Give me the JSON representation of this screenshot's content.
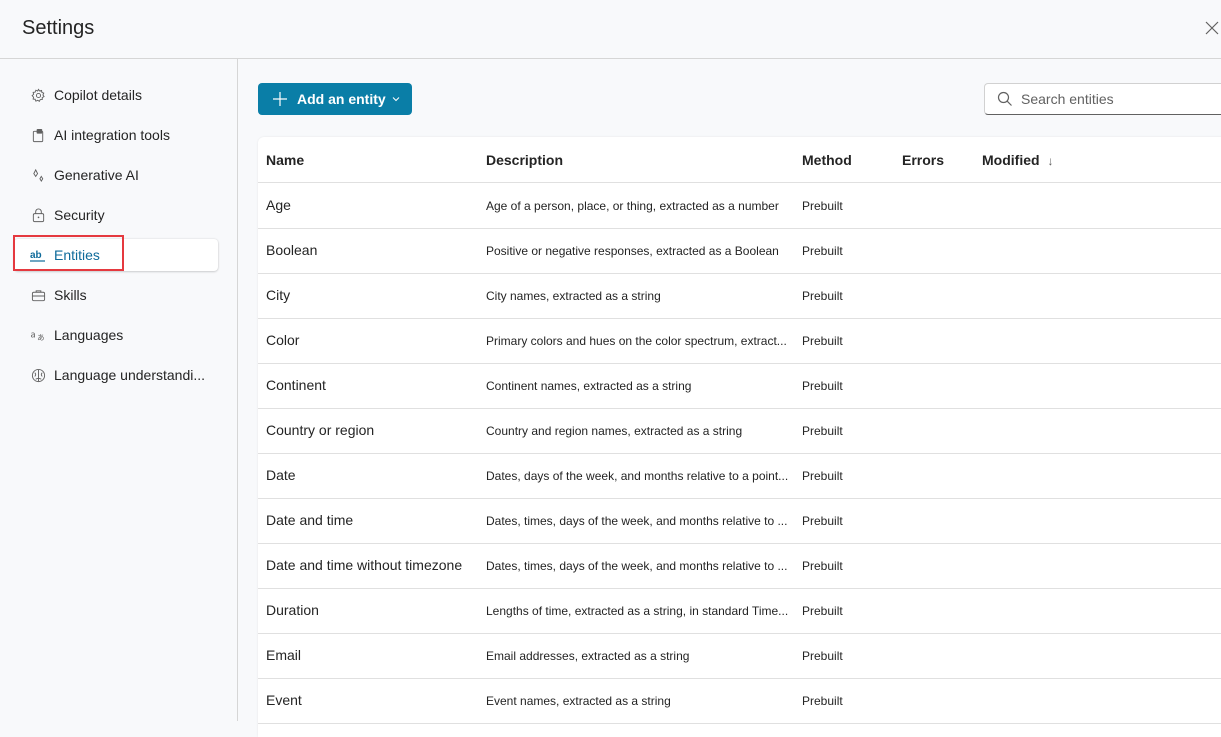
{
  "header": {
    "title": "Settings",
    "close_icon": "close-icon"
  },
  "sidebar": {
    "items": [
      {
        "label": "Copilot details",
        "icon": "gear-icon",
        "active": false
      },
      {
        "label": "AI integration tools",
        "icon": "clipboard-tool-icon",
        "active": false
      },
      {
        "label": "Generative AI",
        "icon": "sparkle-icon",
        "active": false
      },
      {
        "label": "Security",
        "icon": "lock-icon",
        "active": false
      },
      {
        "label": "Entities",
        "icon": "text-ab-icon",
        "active": true
      },
      {
        "label": "Skills",
        "icon": "briefcase-icon",
        "active": false
      },
      {
        "label": "Languages",
        "icon": "language-icon",
        "active": false
      },
      {
        "label": "Language understandi...",
        "icon": "brain-icon",
        "active": false
      }
    ]
  },
  "toolbar": {
    "add_label": "Add an entity",
    "search_placeholder": "Search entities",
    "search_value": ""
  },
  "table": {
    "columns": [
      "Name",
      "Description",
      "Method",
      "Errors",
      "Modified"
    ],
    "sort_indicator": "↓",
    "rows": [
      {
        "name": "Age",
        "description": "Age of a person, place, or thing, extracted as a number",
        "method": "Prebuilt",
        "errors": "",
        "modified": ""
      },
      {
        "name": "Boolean",
        "description": "Positive or negative responses, extracted as a Boolean",
        "method": "Prebuilt",
        "errors": "",
        "modified": ""
      },
      {
        "name": "City",
        "description": "City names, extracted as a string",
        "method": "Prebuilt",
        "errors": "",
        "modified": ""
      },
      {
        "name": "Color",
        "description": "Primary colors and hues on the color spectrum, extract...",
        "method": "Prebuilt",
        "errors": "",
        "modified": ""
      },
      {
        "name": "Continent",
        "description": "Continent names, extracted as a string",
        "method": "Prebuilt",
        "errors": "",
        "modified": ""
      },
      {
        "name": "Country or region",
        "description": "Country and region names, extracted as a string",
        "method": "Prebuilt",
        "errors": "",
        "modified": ""
      },
      {
        "name": "Date",
        "description": "Dates, days of the week, and months relative to a point...",
        "method": "Prebuilt",
        "errors": "",
        "modified": ""
      },
      {
        "name": "Date and time",
        "description": "Dates, times, days of the week, and months relative to ...",
        "method": "Prebuilt",
        "errors": "",
        "modified": ""
      },
      {
        "name": "Date and time without timezone",
        "description": "Dates, times, days of the week, and months relative to ...",
        "method": "Prebuilt",
        "errors": "",
        "modified": ""
      },
      {
        "name": "Duration",
        "description": "Lengths of time, extracted as a string, in standard Time...",
        "method": "Prebuilt",
        "errors": "",
        "modified": ""
      },
      {
        "name": "Email",
        "description": "Email addresses, extracted as a string",
        "method": "Prebuilt",
        "errors": "",
        "modified": ""
      },
      {
        "name": "Event",
        "description": "Event names, extracted as a string",
        "method": "Prebuilt",
        "errors": "",
        "modified": ""
      }
    ]
  },
  "colors": {
    "accent": "#0a7ea7",
    "active_text": "#0e6a9a",
    "highlight_border": "#e5393f"
  }
}
